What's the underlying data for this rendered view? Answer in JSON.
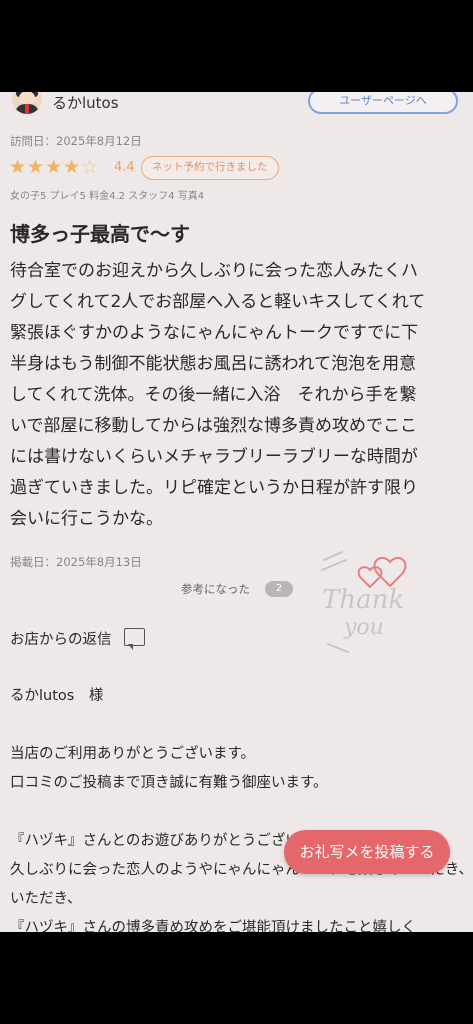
{
  "review": {
    "username": "るかlutos",
    "user_page_button": "ユーザーページへ",
    "visit_date": "訪問日：2025年8月12日",
    "stars_filled": "★★★★",
    "stars_empty": "☆",
    "rating_value": "4.4",
    "rating_fraction": 0.88,
    "reservation_badge": "ネット予約で行きました",
    "subscores": "女の子5 プレイ5 料金4.2 スタッフ4 写真4",
    "title": "博多っ子最高で〜す",
    "body_lines": [
      "待合室でのお迎えから久しぶりに会った恋人みたくハ",
      "グしてくれて2人でお部屋へ入ると軽いキスしてくれて",
      "緊張ほぐすかのようなにゃんにゃんトークですでに下",
      "半身はもう制御不能状態お風呂に誘われて泡泡を用意",
      "してくれて洗体。その後一緒に入浴　それから手を繋",
      "いで部屋に移動してからは強烈な博多責め攻めでここ",
      "には書けないくらいメチャラブリーラブリーな時間が",
      "過ぎていきました。リピ確定というか日程が許す限り",
      "会いに行こうかな。"
    ],
    "posted_date": "掲載日：2025年8月13日",
    "helpful_label": "参考になった",
    "helpful_count": "2",
    "thanks_stamp_text": [
      "Thank",
      "you"
    ]
  },
  "reply": {
    "label": "お店からの返信",
    "lines": [
      "るかlutos　様",
      "",
      "当店のご利用ありがとうございます。",
      "口コミのご投稿まで頂き誠に有難う御座います。",
      "",
      "『ハヅキ』さんとのお遊びありがとうございます。",
      "久しぶりに会った恋人のようやにゃんにゃんトークを楽しみいただき、",
      "いただき、",
      "『ハヅキ』さんの博多責め攻めをご堪能頂けましたこと嬉しく"
    ]
  },
  "fab_label": "お礼写メを投稿する",
  "colors": {
    "accent_orange": "#e6a75a",
    "fab_red": "#e5676b",
    "link_blue": "#5d86c3",
    "background": "#efe8e8"
  }
}
